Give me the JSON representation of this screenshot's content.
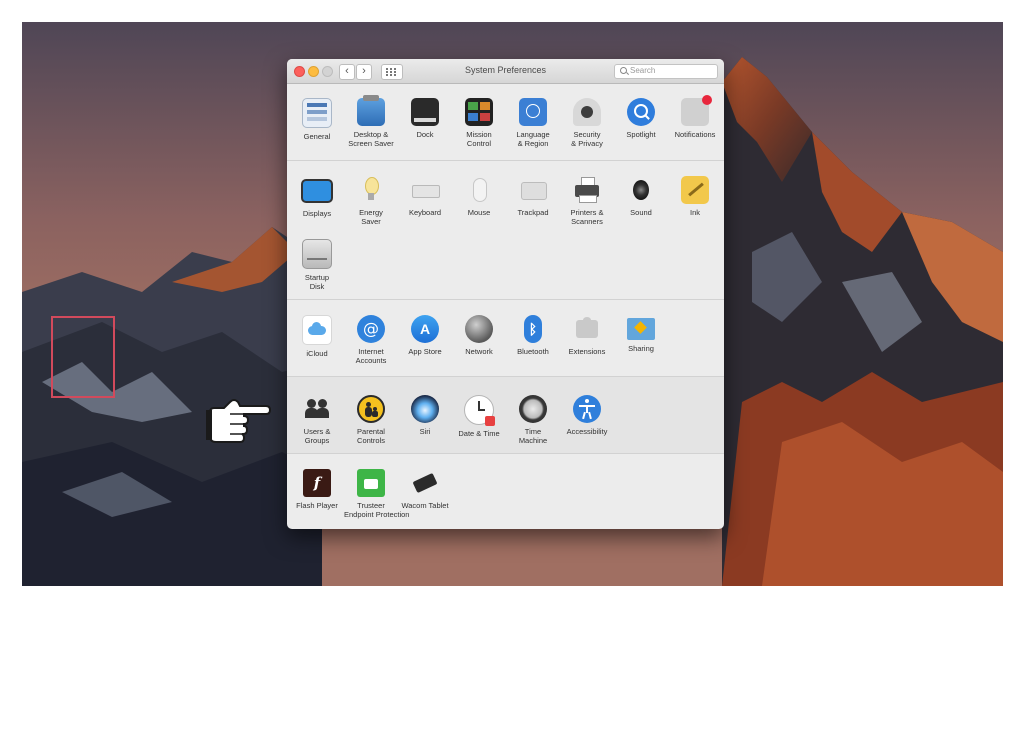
{
  "window": {
    "title": "System Preferences",
    "search_placeholder": "Search",
    "back_label": "‹",
    "forward_label": "›"
  },
  "sections": {
    "personal": [
      {
        "label": "General",
        "icon": "general-icon"
      },
      {
        "label": "Desktop &\nScreen Saver",
        "icon": "desktop-screensaver-icon"
      },
      {
        "label": "Dock",
        "icon": "dock-icon"
      },
      {
        "label": "Mission\nControl",
        "icon": "mission-control-icon"
      },
      {
        "label": "Language\n& Region",
        "icon": "language-region-icon"
      },
      {
        "label": "Security\n& Privacy",
        "icon": "security-privacy-icon"
      },
      {
        "label": "Spotlight",
        "icon": "spotlight-icon"
      },
      {
        "label": "Notifications",
        "icon": "notifications-icon"
      }
    ],
    "hardware": [
      {
        "label": "Displays",
        "icon": "displays-icon"
      },
      {
        "label": "Energy\nSaver",
        "icon": "energy-saver-icon"
      },
      {
        "label": "Keyboard",
        "icon": "keyboard-icon"
      },
      {
        "label": "Mouse",
        "icon": "mouse-icon"
      },
      {
        "label": "Trackpad",
        "icon": "trackpad-icon"
      },
      {
        "label": "Printers &\nScanners",
        "icon": "printer-icon"
      },
      {
        "label": "Sound",
        "icon": "sound-icon"
      },
      {
        "label": "Ink",
        "icon": "ink-icon"
      },
      {
        "label": "Startup\nDisk",
        "icon": "startup-disk-icon"
      }
    ],
    "internet": [
      {
        "label": "iCloud",
        "icon": "icloud-icon"
      },
      {
        "label": "Internet\nAccounts",
        "icon": "internet-accounts-icon"
      },
      {
        "label": "App Store",
        "icon": "app-store-icon"
      },
      {
        "label": "Network",
        "icon": "network-icon"
      },
      {
        "label": "Bluetooth",
        "icon": "bluetooth-icon"
      },
      {
        "label": "Extensions",
        "icon": "extensions-icon"
      },
      {
        "label": "Sharing",
        "icon": "sharing-icon"
      }
    ],
    "system": [
      {
        "label": "Users &\nGroups",
        "icon": "users-groups-icon"
      },
      {
        "label": "Parental\nControls",
        "icon": "parental-controls-icon"
      },
      {
        "label": "Siri",
        "icon": "siri-icon"
      },
      {
        "label": "Date & Time",
        "icon": "date-time-icon"
      },
      {
        "label": "Time\nMachine",
        "icon": "time-machine-icon"
      },
      {
        "label": "Accessibility",
        "icon": "accessibility-icon"
      }
    ],
    "other": [
      {
        "label": "Flash Player",
        "icon": "flash-player-icon"
      },
      {
        "label": "Trusteer\nEndpoint Protection",
        "icon": "trusteer-icon"
      },
      {
        "label": "Wacom Tablet",
        "icon": "wacom-tablet-icon"
      }
    ]
  },
  "highlight_color": "#d24a5c"
}
